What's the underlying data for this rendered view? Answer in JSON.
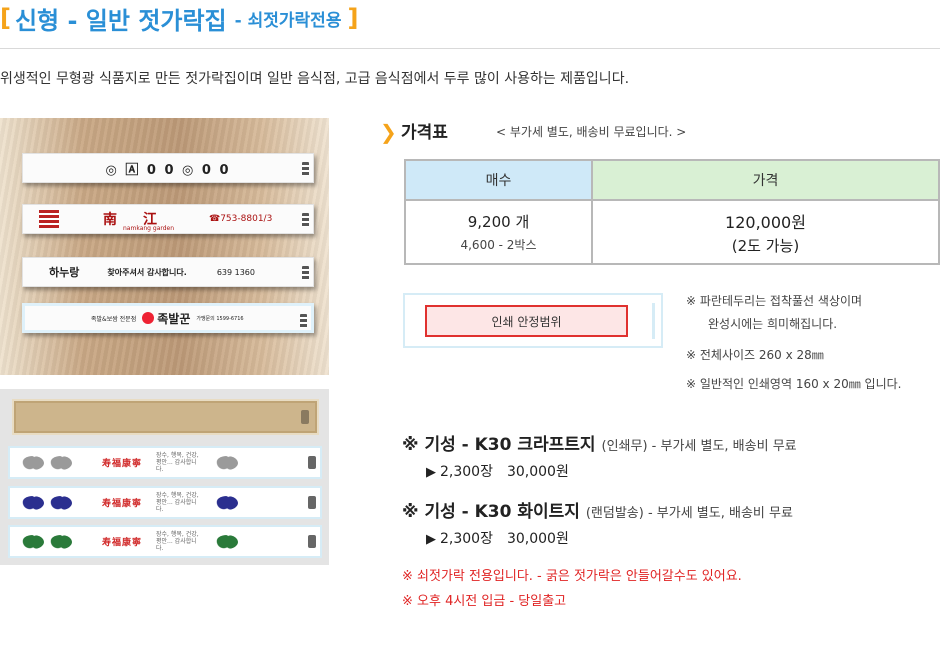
{
  "header": {
    "bracket_open": "[",
    "title": "신형 - 일반 젓가락집",
    "subtitle": "- 쇠젓가락전용",
    "bracket_close": "]"
  },
  "intro": "위생적인 무형광 식품지로 만든 젓가락집이며 일반 음식점, 고급 음식점에서 두루 많이 사용하는 제품입니다.",
  "photos": {
    "sleeve1_text": "◎ 🄰 0 0 ◎ 0 0",
    "sleeve2_left": "南　江",
    "sleeve2_sub": "namkang garden",
    "sleeve2_right": "☎753-8801/3",
    "sleeve3_brand": "하누랑",
    "sleeve3_mid": "찾아주셔서 감사합니다.",
    "sleeve3_right": "639 1360",
    "sleeve4_left": "족발&보쌈 전문점",
    "sleeve4_brand": "족발꾼",
    "sleeve4_right": "가맹문의 1599-6716",
    "kraft_label": "",
    "white_red_text": "寿福康寧",
    "white_small_text": "장수, 행복, 건강, 평안... 감사합니다."
  },
  "price_section": {
    "arrow": "❯",
    "title": "가격표",
    "note": "< 부가세 별도, 배송비 무료입니다. >",
    "headers": [
      "매수",
      "가격"
    ],
    "rows": [
      {
        "qty": "9,200 개",
        "qty_sub": "4,600 - 2박스",
        "price": "120,000원",
        "price_sub": "(2도 가능)"
      }
    ]
  },
  "print_area": {
    "label": "인쇄 안정범위",
    "notes": [
      "※ 파란테두리는 접착풀선 색상이며",
      "완성시에는 희미해집니다.",
      "※ 전체사이즈 260 x 28㎜",
      "※ 일반적인 인쇄영역 160 x 20㎜ 입니다."
    ]
  },
  "options": [
    {
      "title": "※ 기성 - K30 크라프트지",
      "detail": "(인쇄무) - 부가세 별도, 배송비 무료",
      "price": "2,300장　30,000원"
    },
    {
      "title": "※ 기성 - K30 화이트지",
      "detail": "(랜덤발송) - 부가세 별도, 배송비 무료",
      "price": "2,300장　30,000원"
    }
  ],
  "warnings": [
    "※ 쇠젓가락 전용입니다. - 굵은 젓가락은 안들어갈수도 있어요.",
    "※ 오후 4시전 입금 - 당일출고"
  ],
  "colors": {
    "accent_orange": "#f5a31a",
    "title_blue": "#2a8fd6",
    "warning_red": "#e02424",
    "header_qty_bg": "#cfe9f8",
    "header_price_bg": "#d9f0d4"
  },
  "flower_colors": [
    "#9a9a9a",
    "#2b2f8f",
    "#2a7a3a"
  ]
}
